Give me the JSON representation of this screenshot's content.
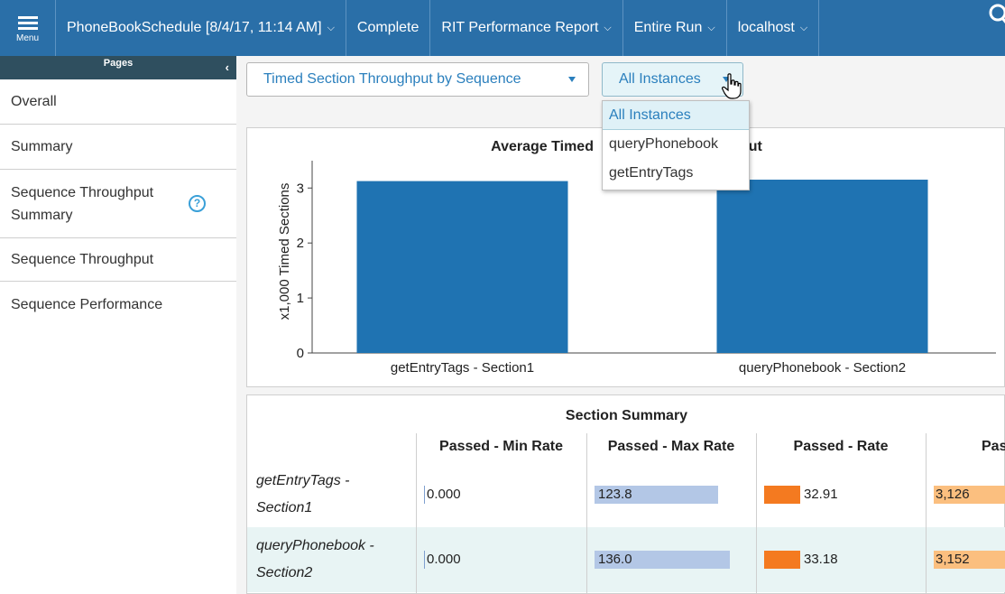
{
  "topbar": {
    "menu_label": "Menu",
    "schedule": "PhoneBookSchedule [8/4/17, 11:14 AM]",
    "status": "Complete",
    "report": "RIT Performance Report",
    "range": "Entire Run",
    "host": "localhost"
  },
  "sidebar": {
    "title": "Pages",
    "items": [
      {
        "label": "Overall"
      },
      {
        "label": "Summary"
      },
      {
        "label": "Sequence Throughput Summary"
      },
      {
        "label": "Sequence Throughput"
      },
      {
        "label": "Sequence Performance"
      }
    ]
  },
  "toolbar": {
    "view_select": "Timed Section Throughput by Sequence",
    "instance_select": "All Instances",
    "instance_options": [
      "All Instances",
      "queryPhonebook",
      "getEntryTags"
    ]
  },
  "chart_data": {
    "type": "bar",
    "title": "Average Timed Section Throughput",
    "title_visible_left": "Average Timed",
    "title_visible_right": "put",
    "ylabel": "x1,000 Timed Sections",
    "ylim": [
      0,
      3.3
    ],
    "yticks": [
      "0",
      "1",
      "2",
      "3"
    ],
    "categories": [
      "getEntryTags - Section1",
      "queryPhonebook - Section2"
    ],
    "values": [
      3.126,
      3.152
    ],
    "color": "#1f73b2",
    "grid": false
  },
  "table": {
    "title": "Section Summary",
    "columns": [
      "Passed - Min Rate",
      "Passed - Max Rate",
      "Passed - Rate",
      "Pas"
    ],
    "rows": [
      {
        "name_line1": "getEntryTags -",
        "name_line2": "Section1",
        "min": "0.000",
        "max": "123.8",
        "rate": "32.91",
        "count": "3,126"
      },
      {
        "name_line1": "queryPhonebook -",
        "name_line2": "Section2",
        "min": "0.000",
        "max": "136.0",
        "rate": "33.18",
        "count": "3,152"
      }
    ],
    "bars": {
      "max_fill": [
        0.91,
        1.0
      ],
      "rate_fill": [
        0.992,
        1.0
      ],
      "count_fill": [
        0.992,
        1.0
      ]
    },
    "colors": {
      "max": "#b3c7e6",
      "rate": "#f47a20",
      "count": "#fbbf7f"
    }
  }
}
